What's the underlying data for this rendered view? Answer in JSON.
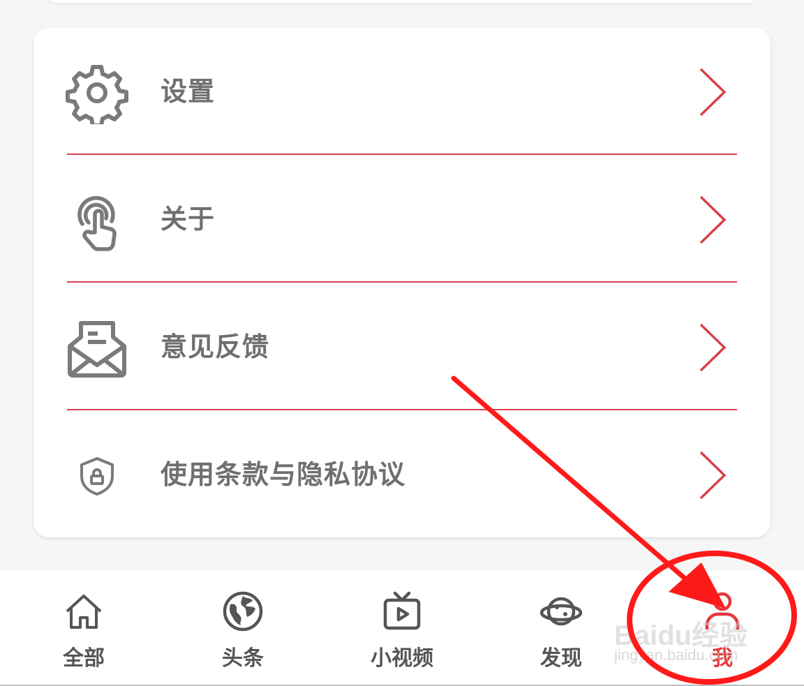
{
  "menu": {
    "items": [
      {
        "label": "设置",
        "icon": "gear-icon"
      },
      {
        "label": "关于",
        "icon": "touch-hand-icon"
      },
      {
        "label": "意见反馈",
        "icon": "mail-letter-icon"
      },
      {
        "label": "使用条款与隐私协议",
        "icon": "shield-lock-icon"
      }
    ],
    "chevron_icon": "chevron-right-icon",
    "accent_color": "#d9404a",
    "text_color": "#6f6f6f"
  },
  "tabbar": {
    "tabs": [
      {
        "label": "全部",
        "icon": "home-icon",
        "active": false
      },
      {
        "label": "头条",
        "icon": "globe-icon",
        "active": false
      },
      {
        "label": "小视频",
        "icon": "tv-play-icon",
        "active": false
      },
      {
        "label": "发现",
        "icon": "planet-icon",
        "active": false
      },
      {
        "label": "我",
        "icon": "user-icon",
        "active": true
      }
    ],
    "active_color": "#e4393c",
    "inactive_color": "#555555"
  },
  "annotation": {
    "arrow_color": "#ff1a1a",
    "target": "tab-me"
  },
  "watermark": {
    "brand": "Baidu经验",
    "url": "jingyan.baidu.com"
  }
}
